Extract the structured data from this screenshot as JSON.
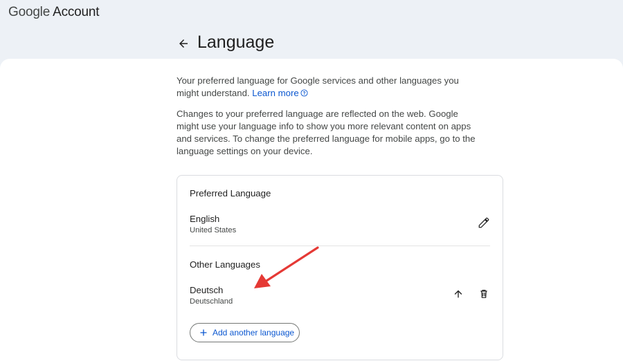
{
  "header": {
    "brand_google": "Google",
    "brand_account": "Account",
    "page_title": "Language"
  },
  "intro": {
    "text": "Your preferred language for Google services and other languages you might understand.",
    "learn_more": "Learn more",
    "details": "Changes to your preferred language are reflected on the web. Google might use your language info to show you more relevant content on apps and services. To change the preferred language for mobile apps, go to the language settings on your device."
  },
  "preferred": {
    "title": "Preferred Language",
    "language": "English",
    "region": "United States"
  },
  "other": {
    "title": "Other Languages",
    "items": [
      {
        "language": "Deutsch",
        "region": "Deutschland"
      }
    ]
  },
  "actions": {
    "add_language": "Add another language"
  },
  "colors": {
    "accent": "#0b57d0",
    "annotation_arrow": "#e53935"
  }
}
